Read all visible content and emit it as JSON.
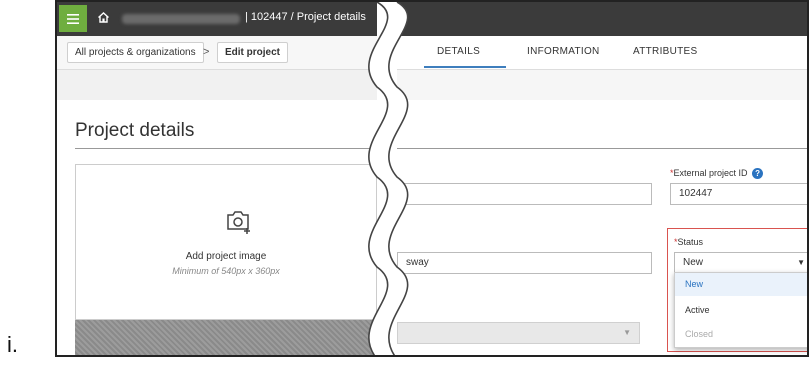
{
  "list_marker": "i.",
  "topbar": {
    "project_crumb": "| 102447  /  Project details"
  },
  "breadcrumb": {
    "all_projects": "All projects & organizations",
    "separator": ">",
    "edit_project": "Edit project"
  },
  "tabs": [
    {
      "label": "DETAILS",
      "active": true
    },
    {
      "label": "INFORMATION",
      "active": false
    },
    {
      "label": "ATTRIBUTES",
      "active": false
    }
  ],
  "page": {
    "title": "Project details"
  },
  "image_card": {
    "label": "Add project image",
    "hint": "Minimum of 540px x 360px"
  },
  "fields": {
    "external_id": {
      "required": "*",
      "label": "External project ID",
      "value": "102447"
    },
    "name_fragment": "sway",
    "status": {
      "required": "*",
      "label": "Status",
      "value": "New",
      "options": [
        "New",
        "Active",
        "Closed"
      ],
      "highlighted": "New"
    }
  },
  "colors": {
    "accent": "#3e7ebd",
    "menu_green": "#6fae3f",
    "highlight_border": "#d9534f",
    "topbar": "#3b3b3b"
  }
}
